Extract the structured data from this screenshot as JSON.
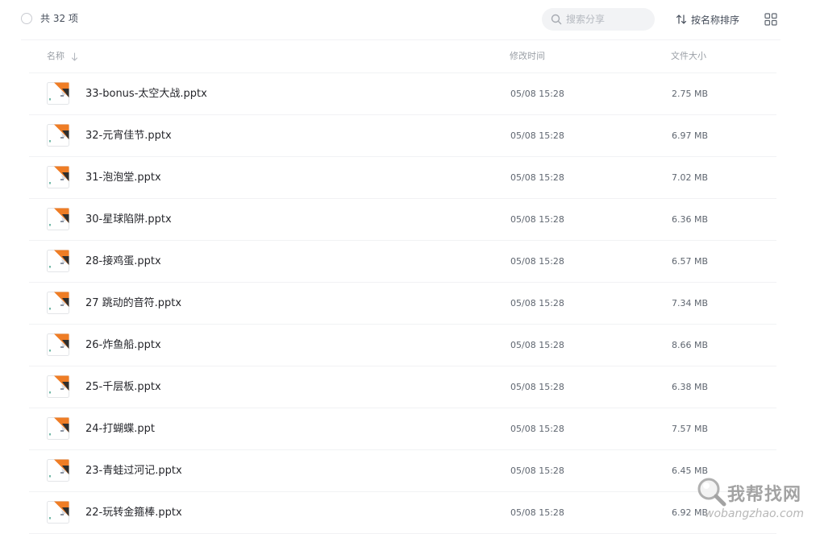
{
  "toolbar": {
    "count_label": "共 32 项",
    "search_placeholder": "搜索分享",
    "sort_label": "按名称排序"
  },
  "table": {
    "headers": {
      "name": "名称",
      "modified": "修改时间",
      "size": "文件大小"
    },
    "rows": [
      {
        "name": "33-bonus-太空大战.pptx",
        "modified": "05/08 15:28",
        "size": "2.75 MB"
      },
      {
        "name": "32-元宵佳节.pptx",
        "modified": "05/08 15:28",
        "size": "6.97 MB"
      },
      {
        "name": "31-泡泡堂.pptx",
        "modified": "05/08 15:28",
        "size": "7.02 MB"
      },
      {
        "name": "30-星球陷阱.pptx",
        "modified": "05/08 15:28",
        "size": "6.36 MB"
      },
      {
        "name": "28-接鸡蛋.pptx",
        "modified": "05/08 15:28",
        "size": "6.57 MB"
      },
      {
        "name": "27 跳动的音符.pptx",
        "modified": "05/08 15:28",
        "size": "7.34 MB"
      },
      {
        "name": "26-炸鱼船.pptx",
        "modified": "05/08 15:28",
        "size": "8.66 MB"
      },
      {
        "name": "25-千层板.pptx",
        "modified": "05/08 15:28",
        "size": "6.38 MB"
      },
      {
        "name": "24-打蝴蝶.ppt",
        "modified": "05/08 15:28",
        "size": "7.57 MB"
      },
      {
        "name": "23-青蛙过河记.pptx",
        "modified": "05/08 15:28",
        "size": "6.45 MB"
      },
      {
        "name": "22-玩转金箍棒.pptx",
        "modified": "05/08 15:28",
        "size": "6.92 MB"
      }
    ]
  },
  "watermark": {
    "title": "我帮找网",
    "domain": "wobangzhao.com"
  },
  "colors": {
    "accent": "#ef7d25",
    "text": "#25262b",
    "muted": "#9a9fa6",
    "divider": "#f1f2f4"
  },
  "icons": {
    "select_all": "circle-checkbox-icon",
    "search": "search-icon",
    "sort": "sort-arrows-icon",
    "view": "grid-view-icon",
    "header_sort": "arrow-down-icon",
    "file": "ppt-file-icon"
  }
}
